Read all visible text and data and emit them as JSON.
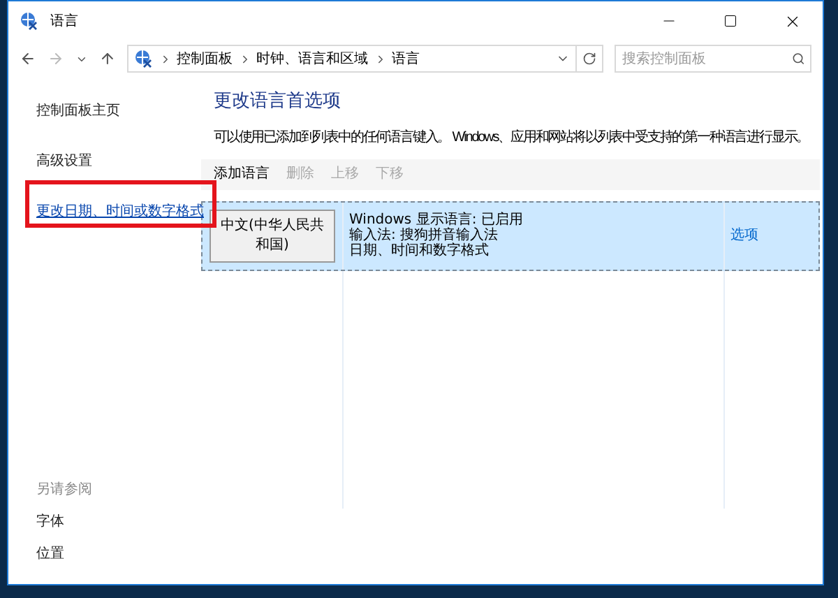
{
  "window": {
    "title": "语言"
  },
  "address_bar": {
    "breadcrumb": [
      "控制面板",
      "时钟、语言和区域",
      "语言"
    ]
  },
  "search": {
    "placeholder": "搜索控制面板"
  },
  "sidebar": {
    "items": [
      {
        "label": "控制面板主页",
        "highlighted": false
      },
      {
        "label": "高级设置",
        "highlighted": false
      },
      {
        "label": "更改日期、时间或数字格式",
        "highlighted": true
      }
    ],
    "see_also": {
      "title": "另请参阅",
      "items": [
        "字体",
        "位置"
      ]
    }
  },
  "main": {
    "heading": "更改语言首选项",
    "description": "可以使用已添加到列表中的任何语言键入。 Windows、应用和网站将以列表中受支持的第一种语言进行显示。",
    "toolbar": [
      {
        "label": "添加语言",
        "disabled": false
      },
      {
        "label": "删除",
        "disabled": true
      },
      {
        "label": "上移",
        "disabled": true
      },
      {
        "label": "下移",
        "disabled": true
      }
    ],
    "languages": [
      {
        "name": "中文(中华人民共和国)",
        "details": [
          "Windows 显示语言: 已启用",
          "输入法: 搜狗拼音输入法",
          "日期、时间和数字格式"
        ],
        "options": "选项",
        "selected": true
      }
    ]
  }
}
